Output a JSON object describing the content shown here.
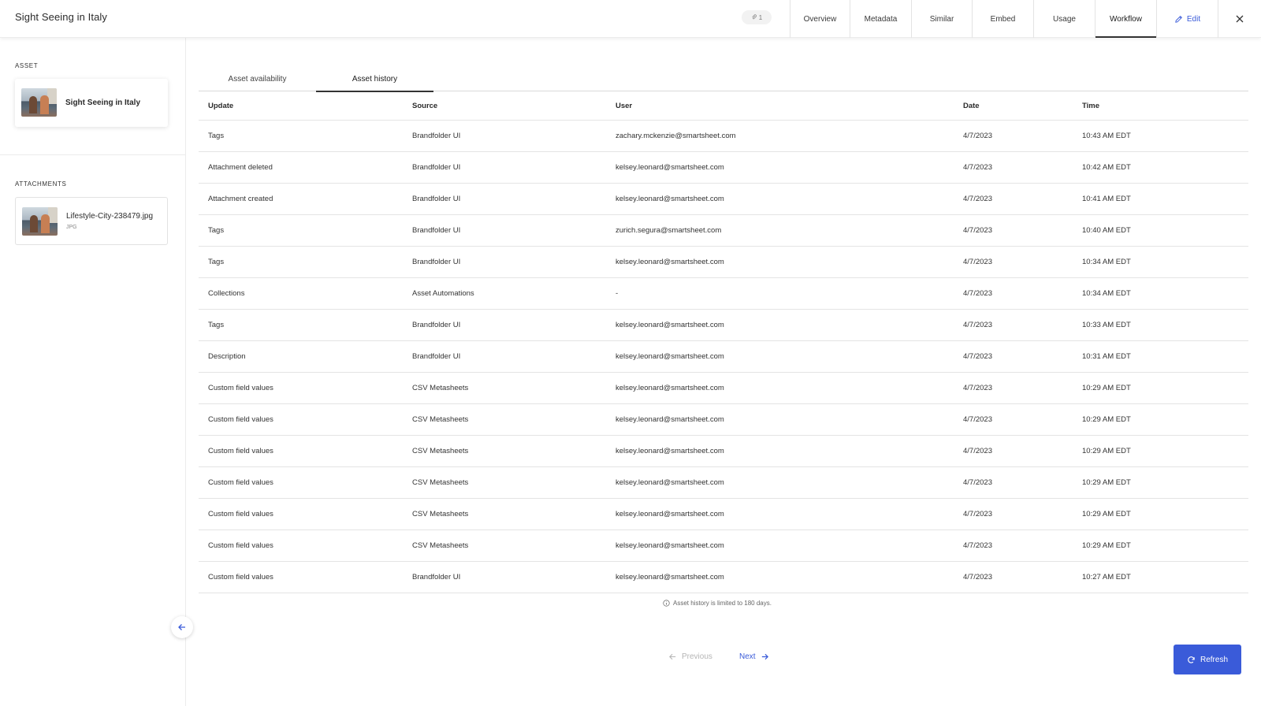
{
  "header": {
    "title": "Sight Seeing in Italy",
    "attachment_count": "1",
    "nav": [
      "Overview",
      "Metadata",
      "Similar",
      "Embed",
      "Usage",
      "Workflow"
    ],
    "active_nav": "Workflow",
    "edit_label": "Edit"
  },
  "sidebar": {
    "asset_label": "ASSET",
    "asset_name": "Sight Seeing in Italy",
    "attachments_label": "ATTACHMENTS",
    "attachment": {
      "name": "Lifestyle-City-238479.jpg",
      "type": "JPG"
    }
  },
  "tabs": [
    "Asset availability",
    "Asset history"
  ],
  "active_tab": "Asset history",
  "table": {
    "columns": [
      "Update",
      "Source",
      "User",
      "Date",
      "Time"
    ],
    "rows": [
      [
        "Tags",
        "Brandfolder UI",
        "zachary.mckenzie@smartsheet.com",
        "4/7/2023",
        "10:43 AM EDT"
      ],
      [
        "Attachment deleted",
        "Brandfolder UI",
        "kelsey.leonard@smartsheet.com",
        "4/7/2023",
        "10:42 AM EDT"
      ],
      [
        "Attachment created",
        "Brandfolder UI",
        "kelsey.leonard@smartsheet.com",
        "4/7/2023",
        "10:41 AM EDT"
      ],
      [
        "Tags",
        "Brandfolder UI",
        "zurich.segura@smartsheet.com",
        "4/7/2023",
        "10:40 AM EDT"
      ],
      [
        "Tags",
        "Brandfolder UI",
        "kelsey.leonard@smartsheet.com",
        "4/7/2023",
        "10:34 AM EDT"
      ],
      [
        "Collections",
        "Asset Automations",
        "-",
        "4/7/2023",
        "10:34 AM EDT"
      ],
      [
        "Tags",
        "Brandfolder UI",
        "kelsey.leonard@smartsheet.com",
        "4/7/2023",
        "10:33 AM EDT"
      ],
      [
        "Description",
        "Brandfolder UI",
        "kelsey.leonard@smartsheet.com",
        "4/7/2023",
        "10:31 AM EDT"
      ],
      [
        "Custom field values",
        "CSV Metasheets",
        "kelsey.leonard@smartsheet.com",
        "4/7/2023",
        "10:29 AM EDT"
      ],
      [
        "Custom field values",
        "CSV Metasheets",
        "kelsey.leonard@smartsheet.com",
        "4/7/2023",
        "10:29 AM EDT"
      ],
      [
        "Custom field values",
        "CSV Metasheets",
        "kelsey.leonard@smartsheet.com",
        "4/7/2023",
        "10:29 AM EDT"
      ],
      [
        "Custom field values",
        "CSV Metasheets",
        "kelsey.leonard@smartsheet.com",
        "4/7/2023",
        "10:29 AM EDT"
      ],
      [
        "Custom field values",
        "CSV Metasheets",
        "kelsey.leonard@smartsheet.com",
        "4/7/2023",
        "10:29 AM EDT"
      ],
      [
        "Custom field values",
        "CSV Metasheets",
        "kelsey.leonard@smartsheet.com",
        "4/7/2023",
        "10:29 AM EDT"
      ],
      [
        "Custom field values",
        "Brandfolder UI",
        "kelsey.leonard@smartsheet.com",
        "4/7/2023",
        "10:27 AM EDT"
      ]
    ]
  },
  "history_note": "Asset history is limited to 180 days.",
  "pagination": {
    "previous": "Previous",
    "next": "Next"
  },
  "refresh_label": "Refresh",
  "colors": {
    "accent": "#3a5bd9"
  }
}
